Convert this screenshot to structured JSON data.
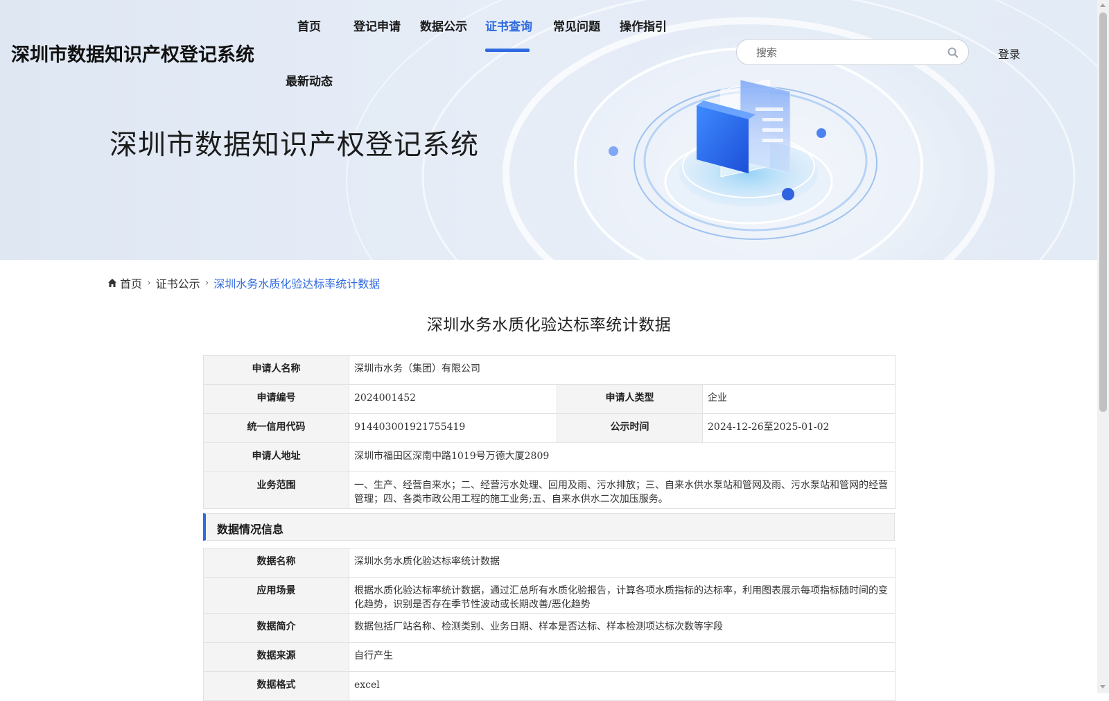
{
  "header": {
    "site_title": "深圳市数据知识产权登记系统",
    "nav": [
      {
        "label": "首页"
      },
      {
        "label": "登记申请"
      },
      {
        "label": "数据公示"
      },
      {
        "label": "证书查询",
        "active": true
      },
      {
        "label": "常见问题"
      },
      {
        "label": "操作指引"
      },
      {
        "label": "最新动态"
      }
    ],
    "search_placeholder": "搜索",
    "login_label": "登录",
    "accent_color": "#2f6ae0"
  },
  "banner": {
    "title": "深圳市数据知识产权登记系统"
  },
  "breadcrumb": {
    "items": [
      "首页",
      "证书公示",
      "深圳水务水质化验达标率统计数据"
    ]
  },
  "page_title": "深圳水务水质化验达标率统计数据",
  "applicant": {
    "name_label": "申请人名称",
    "name": "深圳市水务（集团）有限公司",
    "number_label": "申请编号",
    "number": "2024001452",
    "type_label": "申请人类型",
    "type": "企业",
    "credit_code_label": "统一信用代码",
    "credit_code": "914403001921755419",
    "publish_time_label": "公示时间",
    "publish_time": "2024-12-26至2025-01-02",
    "address_label": "申请人地址",
    "address": "深圳市福田区深南中路1019号万德大厦2809",
    "scope_label": "业务范围",
    "scope": "一、生产、经营自来水；二、经营污水处理、回用及雨、污水排放；三、自来水供水泵站和管网及雨、污水泵站和管网的经营管理；四、各类市政公用工程的施工业务;五、自来水供水二次加压服务。"
  },
  "data_section": {
    "title": "数据情况信息",
    "rows": [
      {
        "label": "数据名称",
        "value": "深圳水务水质化验达标率统计数据"
      },
      {
        "label": "应用场景",
        "value": "根据水质化验达标率统计数据，通过汇总所有水质化验报告，计算各项水质指标的达标率，利用图表展示每项指标随时间的变化趋势，识别是否存在季节性波动或长期改善/恶化趋势"
      },
      {
        "label": "数据简介",
        "value": "数据包括厂站名称、检测类别、业务日期、样本是否达标、样本检测项达标次数等字段"
      },
      {
        "label": "数据来源",
        "value": "自行产生"
      },
      {
        "label": "数据格式",
        "value": "excel"
      }
    ]
  }
}
